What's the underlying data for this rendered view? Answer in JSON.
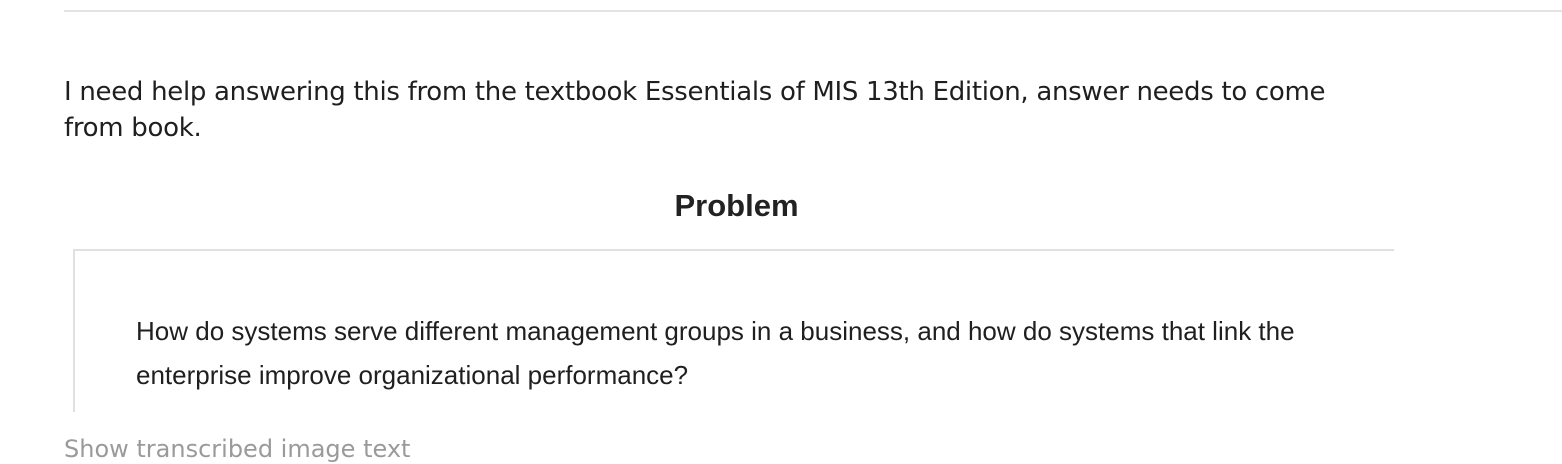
{
  "question": {
    "text": "I need help answering this from the textbook Essentials of MIS 13th Edition, answer needs to come from book."
  },
  "problem": {
    "heading": "Problem",
    "text": "How do systems serve different management groups in a business, and how do systems that link the enterprise improve organizational performance?"
  },
  "footer": {
    "text": "Show transcribed image text"
  }
}
